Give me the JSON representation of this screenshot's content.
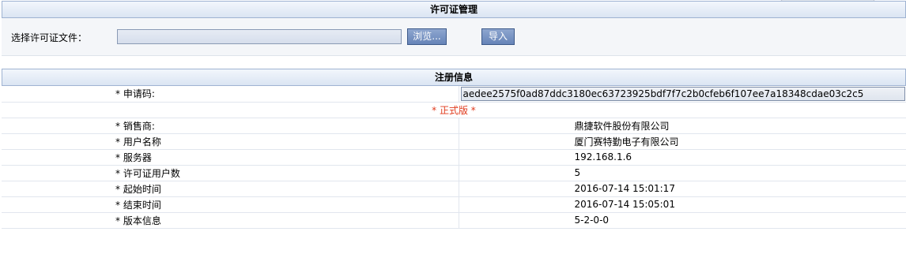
{
  "license_section": {
    "title": "许可证管理",
    "file_label": "选择许可证文件：",
    "file_value": "",
    "browse_label": "浏览...",
    "import_label": "导入"
  },
  "registration": {
    "title": "注册信息",
    "request_code_label": "* 申请码:",
    "request_code_value": "aedee2575f0ad87ddc3180ec63723925bdf7f7c2b0cfeb6f107ee7a18348cdae03c2c5",
    "edition": "* 正式版 *",
    "rows": [
      {
        "label": "* 销售商:",
        "value": "鼎捷软件股份有限公司"
      },
      {
        "label": "* 用户名称",
        "value": "厦门赛特勤电子有限公司"
      },
      {
        "label": "* 服务器",
        "value": "192.168.1.6"
      },
      {
        "label": "* 许可证用户数",
        "value": "5"
      },
      {
        "label": "* 起始时间",
        "value": "2016-07-14 15:01:17"
      },
      {
        "label": "* 结束时间",
        "value": "2016-07-14 15:05:01"
      },
      {
        "label": "* 版本信息",
        "value": "5-2-0-0"
      }
    ]
  },
  "colors": {
    "header_border": "#9fb3d2",
    "button_bg": "#6684b8",
    "edition_text": "#e03a1c"
  }
}
